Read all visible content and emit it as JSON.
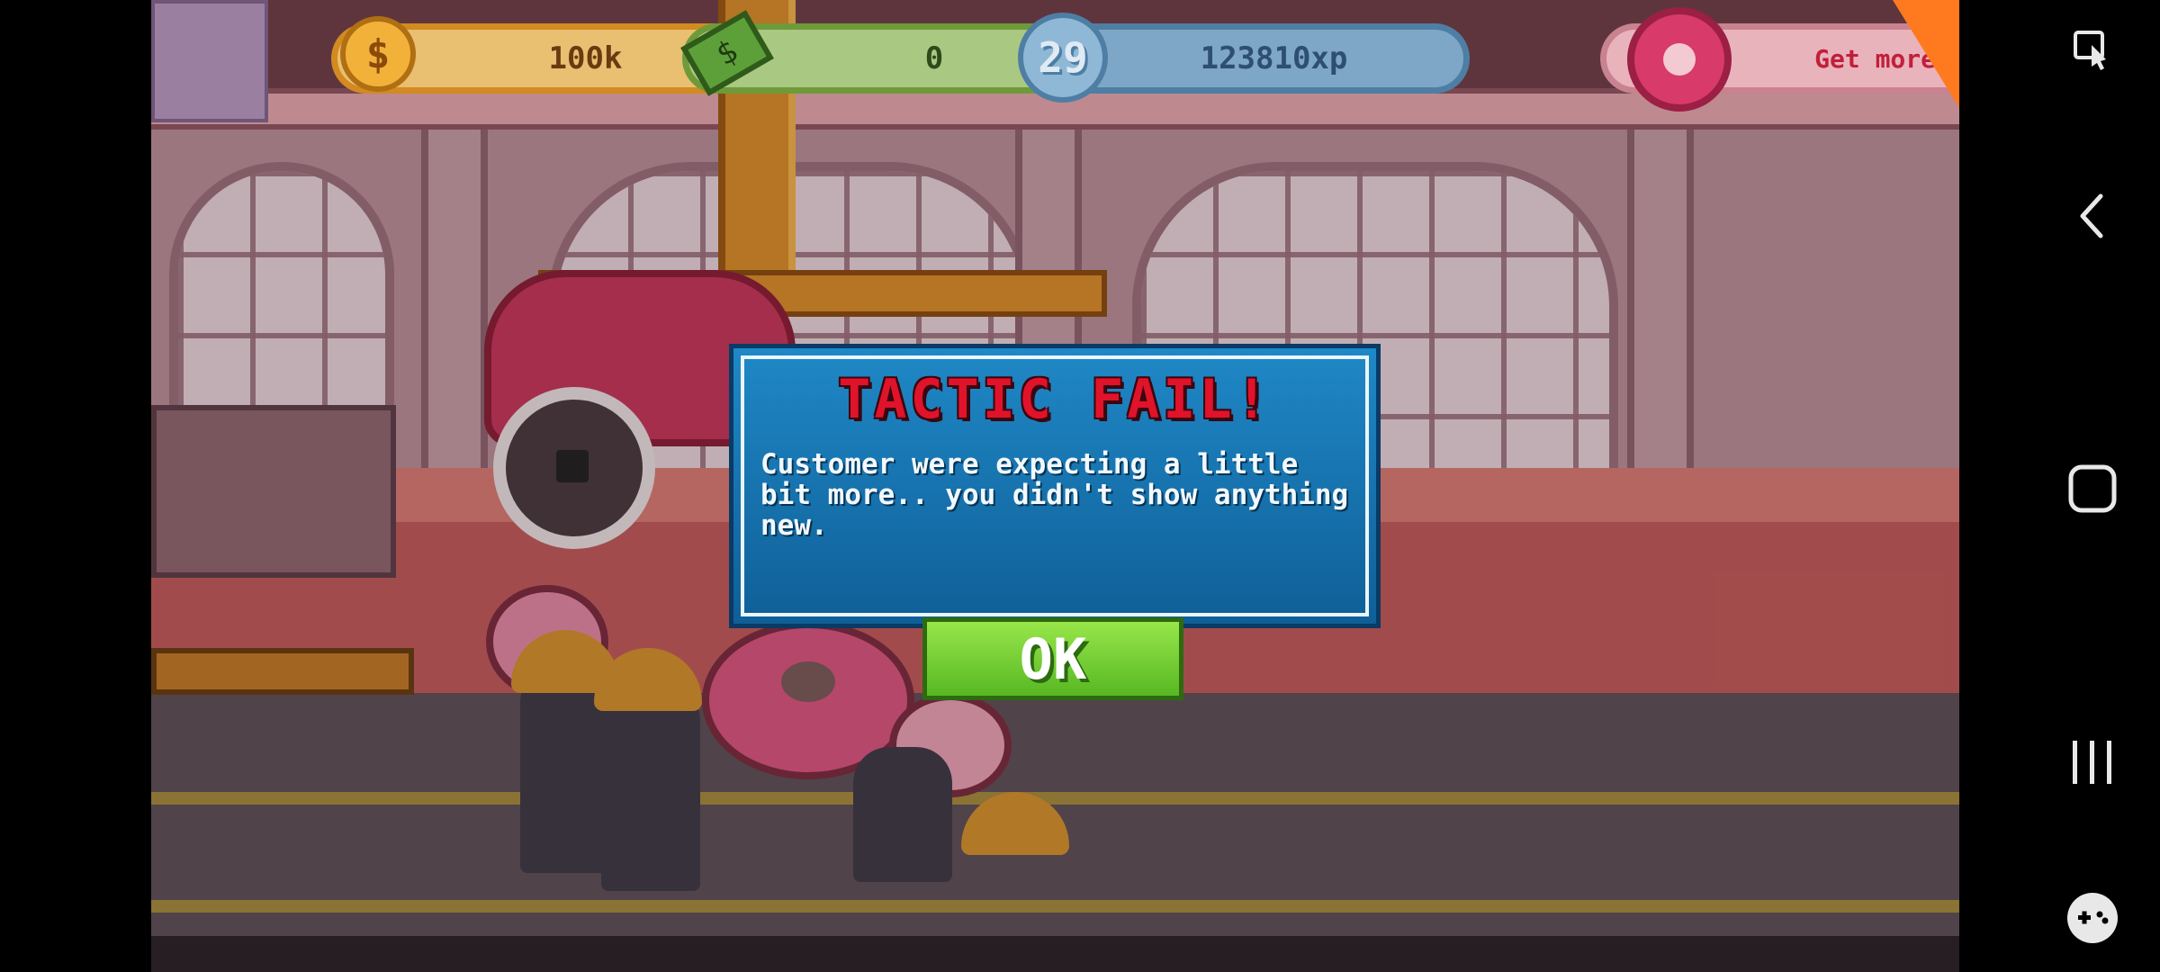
{
  "hud": {
    "coins": "100k",
    "coins_plus": "+",
    "coin_symbol": "$",
    "cash": "0",
    "cash_plus": "+",
    "cash_symbol": "$",
    "level": "29",
    "xp": "123810xp",
    "donut_button": "Get more"
  },
  "dialog": {
    "title": "TACTIC FAIL!",
    "message": "Customer were expecting a little bit more.. you didn't show anything new.",
    "ok_label": "OK"
  },
  "colors": {
    "dialog_bg": "#1f88c6",
    "title_red": "#e0132a",
    "ok_green": "#58b823",
    "accent_orange": "#ff7a1f"
  },
  "system_nav": {
    "icons": [
      "screenshot-icon",
      "back-icon",
      "home-icon",
      "recent-apps-icon",
      "game-launcher-icon"
    ]
  }
}
